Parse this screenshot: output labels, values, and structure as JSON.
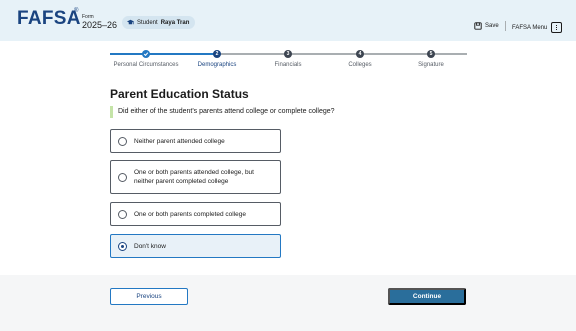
{
  "header": {
    "logo": "FAFSA",
    "logo_mark": "®",
    "form_label": "Form",
    "form_year": "2025–26",
    "student_prefix": "Student",
    "student_name": "Raya Tran",
    "save_label": "Save",
    "menu_label": "FAFSA Menu"
  },
  "stepper": {
    "steps": [
      {
        "label": "Personal Circumstances",
        "number": "1",
        "state": "done"
      },
      {
        "label": "Demographics",
        "number": "2",
        "state": "current"
      },
      {
        "label": "Financials",
        "number": "3",
        "state": "upcoming"
      },
      {
        "label": "Colleges",
        "number": "4",
        "state": "upcoming"
      },
      {
        "label": "Signature",
        "number": "5",
        "state": "upcoming"
      }
    ]
  },
  "main": {
    "title": "Parent Education Status",
    "question": "Did either of the student's parents attend college or complete college?",
    "options": [
      {
        "label": "Neither parent attended college",
        "selected": false
      },
      {
        "label_line1": "One or both parents attended college, but",
        "label_line2": "neither parent completed college",
        "selected": false
      },
      {
        "label": "One or both parents completed college",
        "selected": false
      },
      {
        "label": "Don't know",
        "selected": true
      }
    ]
  },
  "footer": {
    "previous_label": "Previous",
    "continue_label": "Continue"
  },
  "colors": {
    "header_bg": "#e7f2f8",
    "brand": "#1a4480",
    "accent": "#2378c3",
    "continue_bg": "#2a6e9b",
    "question_bar": "#c5e4a8"
  }
}
